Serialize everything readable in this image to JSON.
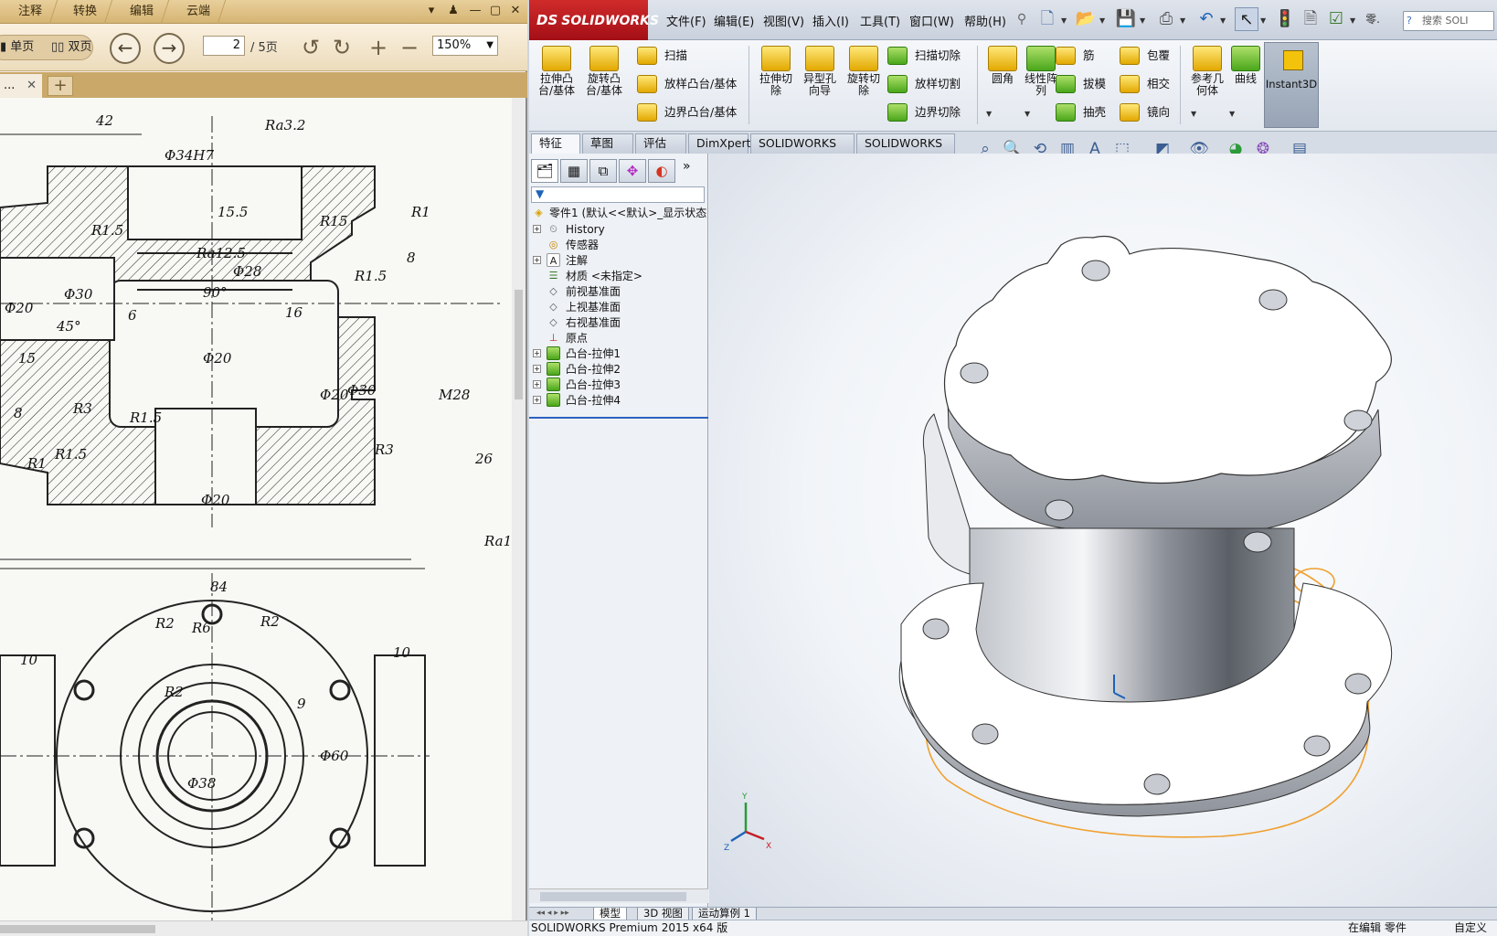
{
  "pdf_reader": {
    "menus": [
      "注释",
      "转换",
      "编辑",
      "云端"
    ],
    "window_controls": [
      "▾",
      "♟",
      "—",
      "▢",
      "✕"
    ],
    "single_page_label": "单页",
    "double_page_label": "双页",
    "page_current": "2",
    "page_total": "/ 5页",
    "zoom": "150%",
    "doc_tab_label": "...",
    "new_tab_label": "+",
    "drawing": {
      "dims": [
        "42",
        "Ra3.2",
        "Φ34H7",
        "15.5",
        "R15",
        "R1.5",
        "R1",
        "Ra12.5",
        "Φ28",
        "90°",
        "R1.5",
        "8",
        "Φ20",
        "Φ30",
        "45°",
        "6",
        "16",
        "Φ20",
        "Φ20",
        "Φ30",
        "M28",
        "15",
        "8",
        "R3",
        "R1.5",
        "R3",
        "R1",
        "R1.5",
        "26",
        "Φ20",
        "Ra1",
        "84",
        "R2",
        "R6",
        "R2",
        "10",
        "10",
        "R2",
        "9",
        "Φ60",
        "Φ38"
      ]
    }
  },
  "solidworks": {
    "logo": "SOLIDWORKS",
    "logo_mark": "DS",
    "menus": [
      "文件(F)",
      "编辑(E)",
      "视图(V)",
      "插入(I)",
      "工具(T)",
      "窗口(W)",
      "帮助(H)"
    ],
    "search_placeholder": "搜索 SOLI",
    "ribbon": {
      "extrude_boss": "拉伸凸\n台/基体",
      "revolve_boss": "旋转凸\n台/基体",
      "sweep": "扫描",
      "loft_boss": "放样凸台/基体",
      "boundary_boss": "边界凸台/基体",
      "extrude_cut": "拉伸切\n除",
      "hole_wizard": "异型孔\n向导",
      "revolve_cut": "旋转切\n除",
      "sweep_cut": "扫描切除",
      "loft_cut": "放样切割",
      "boundary_cut": "边界切除",
      "fillet": "圆角",
      "linear_pattern": "线性阵\n列",
      "rib": "筋",
      "draft": "拔模",
      "shell": "抽壳",
      "wrap": "包覆",
      "intersect": "相交",
      "mirror": "镜向",
      "ref_geometry": "参考几\n何体",
      "curves": "曲线",
      "instant3d": "Instant3D"
    },
    "tabs": [
      "特征",
      "草图",
      "评估",
      "DimXpert",
      "SOLIDWORKS 插件",
      "SOLIDWORKS MBD"
    ],
    "feature_tree": {
      "root": "零件1 (默认<<默认>_显示状态",
      "items": [
        "History",
        "传感器",
        "注解",
        "材质 <未指定>",
        "前视基准面",
        "上视基准面",
        "右视基准面",
        "原点",
        "凸台-拉伸1",
        "凸台-拉伸2",
        "凸台-拉伸3",
        "凸台-拉伸4"
      ]
    },
    "bottom_tabs": [
      "模型",
      "3D 视图",
      "运动算例 1"
    ],
    "status_left": "SOLIDWORKS Premium 2015 x64 版",
    "status_mid": "在编辑 零件",
    "status_right": "自定义",
    "triad_labels": [
      "X",
      "Y",
      "Z"
    ],
    "colors": {
      "brand_red": "#c41e24",
      "highlight_orange": "#f0a030",
      "rollback_bar": "#2d60c2"
    }
  }
}
